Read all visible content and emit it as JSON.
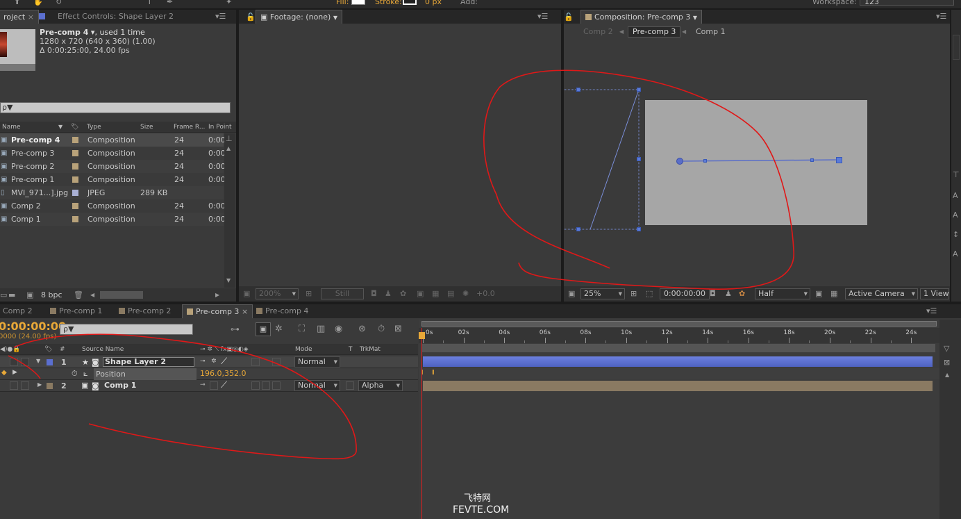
{
  "toolbar": {
    "fill_label": "Fill:",
    "stroke_label": "Stroke:",
    "stroke_width": "0 px",
    "add_label": "Add:",
    "workspace_label": "Workspace:",
    "workspace_value": "123"
  },
  "project_panel": {
    "tab_project": "roject",
    "tab_effect": "Effect Controls: Shape Layer 2",
    "selected_name": "Pre-comp 4",
    "used": ", used 1 time",
    "dims": "1280 x 720  (640 x 360) (1.00)",
    "duration": "Δ 0:00:25:00, 24.00 fps",
    "search_placeholder": "ρ▼",
    "columns": {
      "name": "Name",
      "type": "Type",
      "size": "Size",
      "frame_rate": "Frame R...",
      "in_point": "In Point"
    },
    "items": [
      {
        "name": "Pre-comp 4",
        "type": "Composition",
        "size": "",
        "frame_rate": "24",
        "in_point": "0:00",
        "selected": true
      },
      {
        "name": "Pre-comp 3",
        "type": "Composition",
        "size": "",
        "frame_rate": "24",
        "in_point": "0:00"
      },
      {
        "name": "Pre-comp 2",
        "type": "Composition",
        "size": "",
        "frame_rate": "24",
        "in_point": "0:00"
      },
      {
        "name": "Pre-comp 1",
        "type": "Composition",
        "size": "",
        "frame_rate": "24",
        "in_point": "0:00"
      },
      {
        "name": "MVI_971...].jpg",
        "type": "JPEG",
        "size": "289 KB",
        "frame_rate": "",
        "in_point": ""
      },
      {
        "name": "Comp 2",
        "type": "Composition",
        "size": "",
        "frame_rate": "24",
        "in_point": "0:00"
      },
      {
        "name": "Comp 1",
        "type": "Composition",
        "size": "",
        "frame_rate": "24",
        "in_point": "0:00"
      }
    ],
    "bpc": "8 bpc"
  },
  "footage_panel": {
    "tab": "Footage: (none)",
    "zoom": "200%",
    "still": "Still",
    "exposure": "+0.0"
  },
  "comp_panel": {
    "tab": "Composition: Pre-comp 3",
    "breadcrumbs": [
      "Comp 2",
      "Pre-comp 3",
      "Comp 1"
    ],
    "zoom": "25%",
    "timecode": "0:00:00:00",
    "resolution": "Half",
    "camera": "Active Camera",
    "views": "1 View"
  },
  "timeline": {
    "tabs": [
      "Comp 2",
      "Pre-comp 1",
      "Pre-comp 2",
      "Pre-comp 3",
      "Pre-comp 4"
    ],
    "active_tab": "Pre-comp 3",
    "timecode": "0:00:00:00",
    "fps": "0000 (24.00 fps)",
    "search_placeholder": "ρ▼",
    "col_num": "#",
    "col_source": "Source Name",
    "col_mode": "Mode",
    "col_t": "T",
    "col_trkmat": "TrkMat",
    "switch_fx": "fx",
    "layers": [
      {
        "num": "1",
        "name": "Shape Layer 2",
        "mode": "Normal",
        "trkmat": ""
      },
      {
        "num": "2",
        "name": "Comp 1",
        "mode": "Normal",
        "trkmat": "Alpha"
      }
    ],
    "position_label": "Position",
    "position_value": "196.0,352.0",
    "ruler": [
      "0s",
      "02s",
      "04s",
      "06s",
      "08s",
      "10s",
      "12s",
      "14s",
      "16s",
      "18s",
      "20s",
      "22s",
      "24s"
    ]
  },
  "watermark": {
    "line1": "飞特网",
    "line2": "FEVTE.COM"
  },
  "colors": {
    "accent_orange": "#e8a838",
    "layer_blue": "#5b6fd0",
    "layer_tan": "#8a7a62",
    "annotation_red": "#e01818"
  }
}
